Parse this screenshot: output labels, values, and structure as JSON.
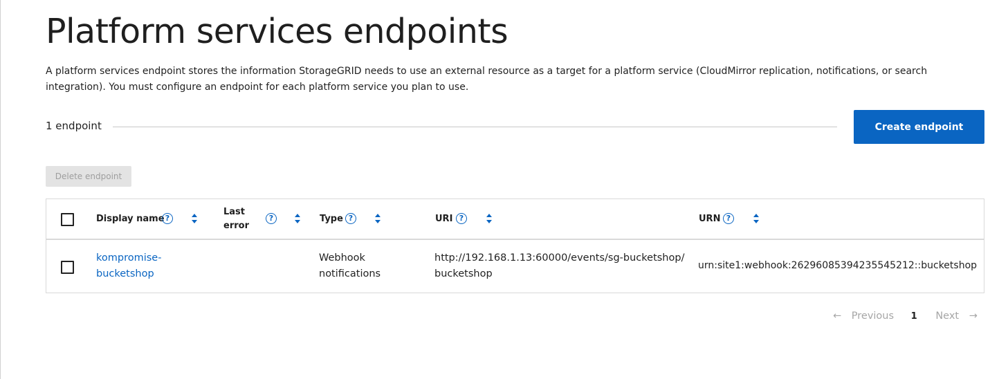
{
  "page": {
    "title": "Platform services endpoints",
    "description": "A platform services endpoint stores the information StorageGRID needs to use an external resource as a target for a platform service (CloudMirror replication, notifications, or search integration). You must configure an endpoint for each platform service you plan to use."
  },
  "toolbar": {
    "count_label": "1 endpoint",
    "create_label": "Create endpoint",
    "delete_label": "Delete endpoint"
  },
  "table": {
    "columns": {
      "display_name": "Display name",
      "last_error_line1": "Last",
      "last_error_line2": "error",
      "type": "Type",
      "uri": "URI",
      "urn": "URN"
    },
    "help_glyph": "?",
    "rows": [
      {
        "display_name_line1": "kompromise-",
        "display_name_line2": "bucketshop",
        "last_error": "",
        "type_line1": "Webhook",
        "type_line2": "notifications",
        "uri_line1": "http://192.168.1.13:60000/events/sg-bucketshop/",
        "uri_line2": "bucketshop",
        "urn": "urn:site1:webhook:2629608539423554521​2::bucketshop"
      }
    ]
  },
  "pagination": {
    "prev_arrow": "←",
    "previous": "Previous",
    "current_page": "1",
    "next": "Next",
    "next_arrow": "→"
  },
  "colors": {
    "accent": "#0a65c2",
    "disabled_bg": "#e3e3e3",
    "disabled_text": "#9e9e9e"
  },
  "icons": [
    "help-icon",
    "sort-icon",
    "arrow-left-icon",
    "arrow-right-icon",
    "checkbox-icon"
  ]
}
